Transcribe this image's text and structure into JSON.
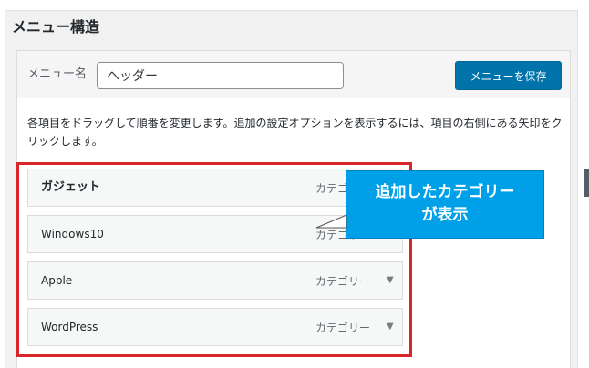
{
  "section": {
    "title": "メニュー構造"
  },
  "header": {
    "menu_name_label": "メニュー名",
    "menu_name_value": "ヘッダー",
    "save_button_label": "メニューを保存"
  },
  "instructions": "各項目をドラッグして順番を変更します。追加の設定オプションを表示するには、項目の右側にある矢印をクリックします。",
  "menu_items": [
    {
      "title": "ガジェット",
      "type": "カテゴリー",
      "arrow": "▼"
    },
    {
      "title": "Windows10",
      "type": "カテゴリー",
      "arrow": "▼"
    },
    {
      "title": "Apple",
      "type": "カテゴリー",
      "arrow": "▼"
    },
    {
      "title": "WordPress",
      "type": "カテゴリー",
      "arrow": "▼"
    }
  ],
  "callout": {
    "line1": "追加したカテゴリー",
    "line2": "が表示"
  },
  "colors": {
    "primary_button": "#0073aa",
    "highlight_border": "#d9262a",
    "callout_background": "#00a0e9"
  }
}
